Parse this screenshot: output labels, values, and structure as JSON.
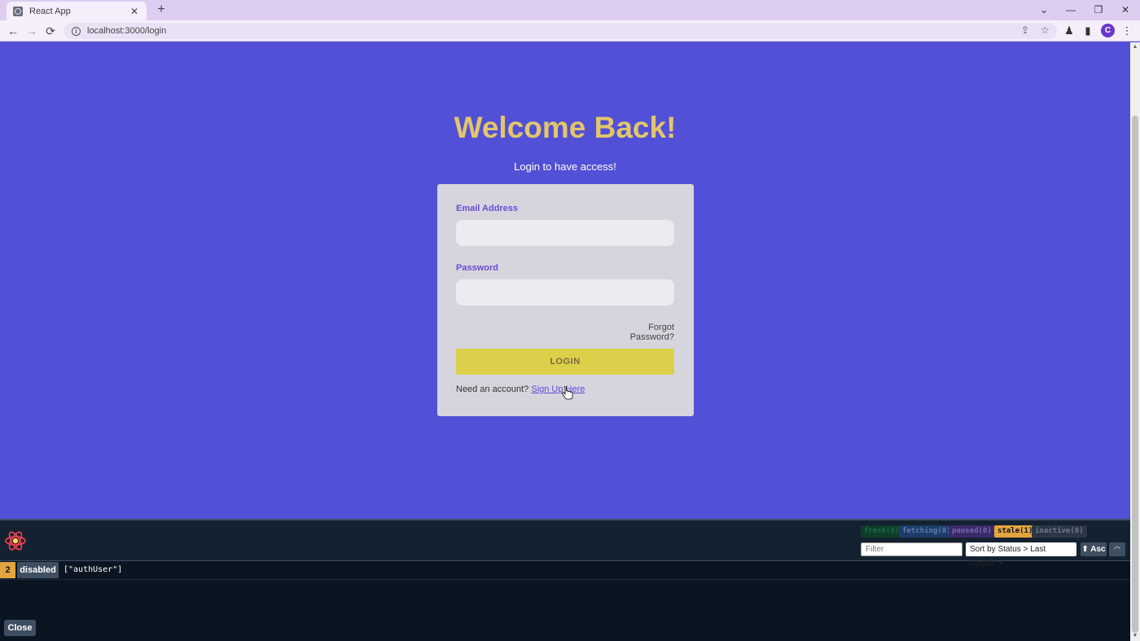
{
  "browser": {
    "tab_title": "React App",
    "tab_close": "✕",
    "new_tab": "+",
    "url": "localhost:3000/login",
    "profile_initial": "C",
    "icons": {
      "back": "back-arrow-icon",
      "forward": "forward-arrow-icon",
      "reload": "reload-icon",
      "info": "info-icon",
      "share": "share-icon",
      "star": "star-icon",
      "extensions": "extensions-icon",
      "sidepanel": "side-panel-icon"
    },
    "window_controls": {
      "tab_search": "⌄",
      "minimize": "—",
      "restore": "❐",
      "close": "✕"
    }
  },
  "login": {
    "heading": "Welcome Back!",
    "subheading": "Login to have access!",
    "email_label": "Email Address",
    "email_value": "",
    "password_label": "Password",
    "password_value": "",
    "forgot_link": "Forgot Password?",
    "login_button": "LOGIN",
    "signup_prompt": "Need an account?",
    "signup_link": "Sign Up Here"
  },
  "devtools": {
    "status_badges": [
      {
        "label": "fresh",
        "count": "(0)"
      },
      {
        "label": "fetching",
        "count": "(0)"
      },
      {
        "label": "paused",
        "count": "(0)"
      },
      {
        "label": "stale",
        "count": "(1)"
      },
      {
        "label": "inactive",
        "count": "(0)"
      }
    ],
    "filter_placeholder": "Filter",
    "sort_label": "Sort by Status > Last Update",
    "sort_direction": "⬆ Asc",
    "queries": [
      {
        "count": "2",
        "status": "disabled",
        "key": "[\"authUser\"]"
      }
    ],
    "close_button": "Close"
  },
  "colors": {
    "page_bg": "#5250d6",
    "heading": "#e2c66b",
    "card_bg": "#d6d5de",
    "label": "#6b4bd6",
    "button": "#dcd04a",
    "devtools_bg": "#0b1521",
    "stale_badge": "#e3a53c"
  }
}
